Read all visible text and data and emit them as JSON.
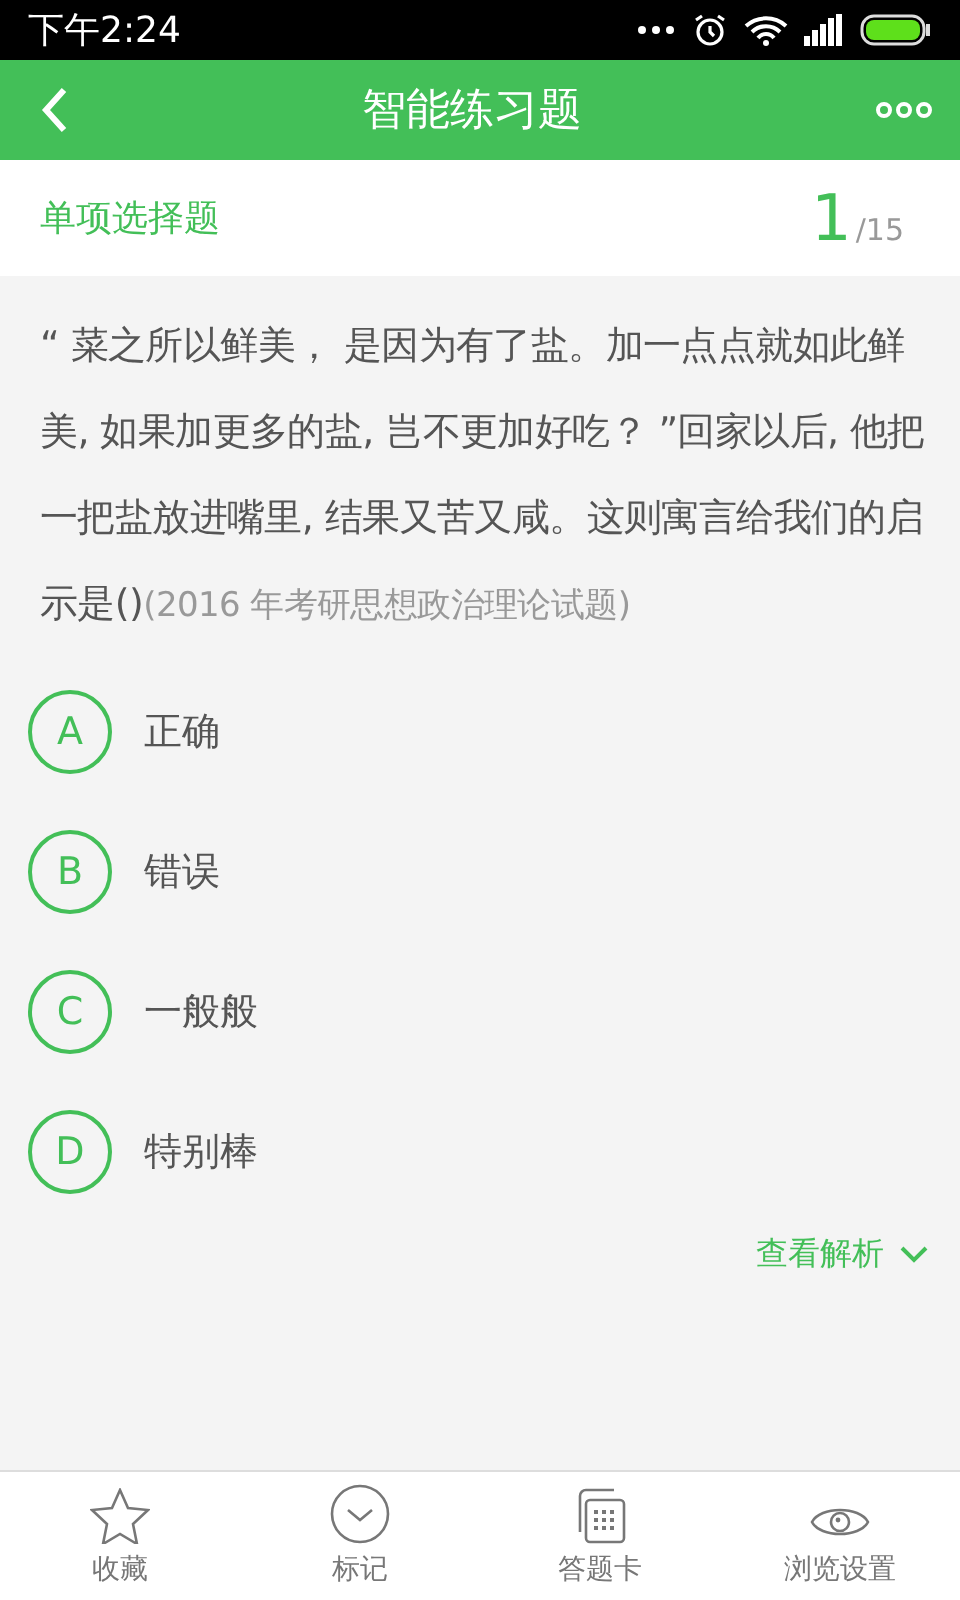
{
  "status_bar": {
    "time": "下午2:24"
  },
  "header": {
    "title": "智能练习题"
  },
  "question_bar": {
    "type": "单项选择题",
    "current": "1",
    "total": "/15"
  },
  "question": {
    "text": "“ 菜之所以鲜美， 是因为有了盐。加一点点就如此鲜美, 如果加更多的盐, 岂不更加好吃？ ”回家以后, 他把一把盐放进嘴里, 结果又苦又咸。这则寓言给我们的启示是()",
    "source": "(2016 年考研思想政治理论试题)"
  },
  "options": [
    {
      "letter": "A",
      "text": "正确"
    },
    {
      "letter": "B",
      "text": "错误"
    },
    {
      "letter": "C",
      "text": "一般般"
    },
    {
      "letter": "D",
      "text": "特别棒"
    }
  ],
  "analysis_link": "查看解析",
  "bottom_nav": [
    {
      "kind": "star",
      "label": "收藏"
    },
    {
      "kind": "check",
      "label": "标记"
    },
    {
      "kind": "card",
      "label": "答题卡"
    },
    {
      "kind": "eye",
      "label": "浏览设置"
    }
  ]
}
